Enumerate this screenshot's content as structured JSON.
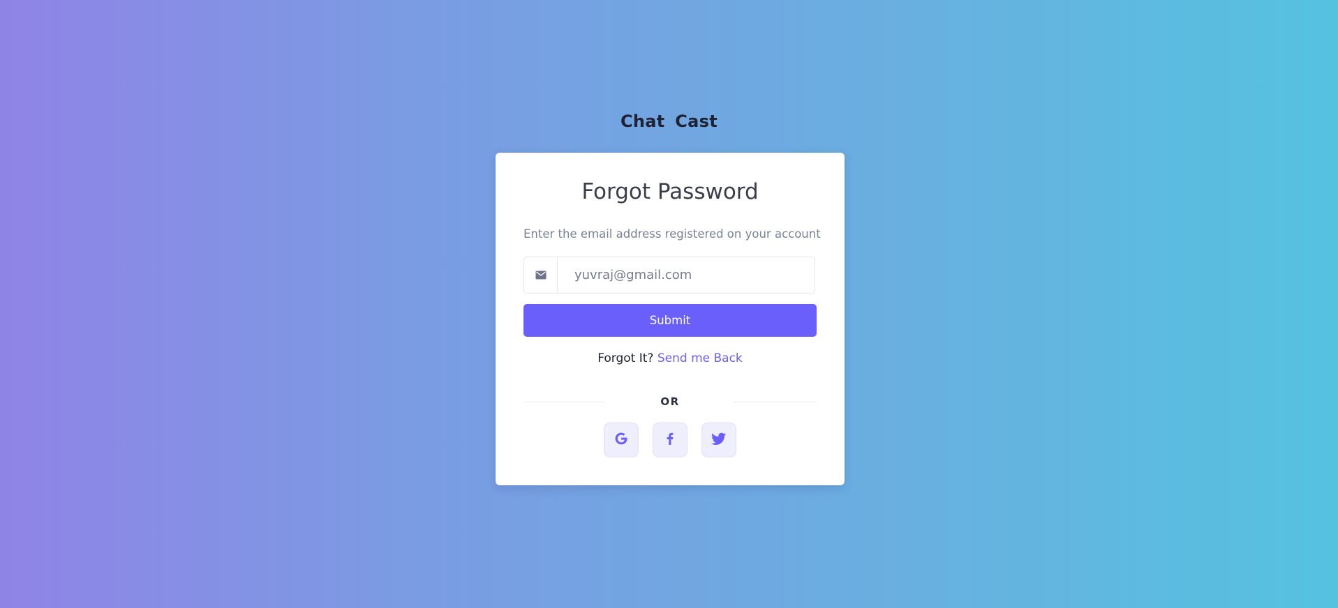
{
  "app": {
    "brand": "Chat  Cast"
  },
  "card": {
    "title": "Forgot Password",
    "subtitle": "Enter the email address registered on your account",
    "email": {
      "icon": "mail-icon",
      "placeholder": "yuvraj@gmail.com",
      "value": ""
    },
    "submit_label": "Submit",
    "back_prompt": "Forgot It?",
    "back_link": "Send me Back",
    "divider_text": "OR",
    "socials": [
      {
        "icon": "google-icon"
      },
      {
        "icon": "facebook-icon"
      },
      {
        "icon": "twitter-icon"
      }
    ]
  },
  "colors": {
    "accent": "#6b5ffb",
    "social_bg": "#efeefc",
    "background_start": "#8f84e6",
    "background_end": "#55c2e0"
  }
}
